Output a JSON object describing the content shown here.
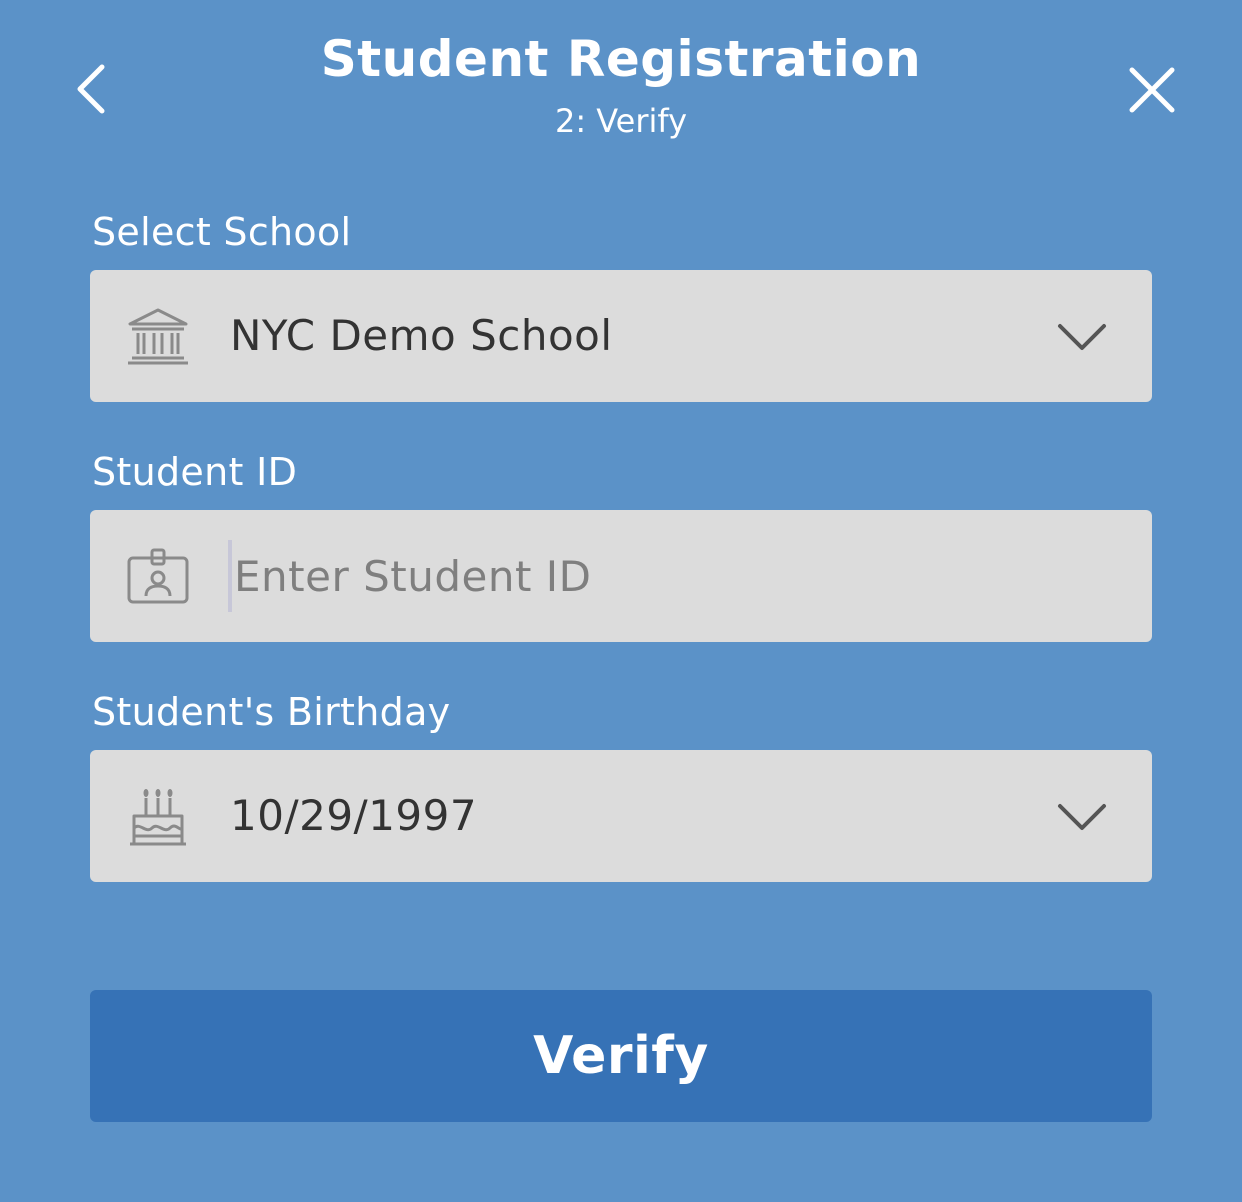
{
  "header": {
    "title": "Student Registration",
    "subtitle": "2: Verify",
    "back_icon": "chevron-left-icon",
    "close_icon": "close-icon"
  },
  "form": {
    "school": {
      "label": "Select School",
      "value": "NYC Demo School",
      "icon": "school-building-icon"
    },
    "student_id": {
      "label": "Student ID",
      "value": "",
      "placeholder": "Enter Student ID",
      "icon": "id-badge-icon"
    },
    "birthday": {
      "label": "Student's Birthday",
      "value": "10/29/1997",
      "icon": "birthday-cake-icon"
    }
  },
  "actions": {
    "verify_label": "Verify"
  },
  "colors": {
    "background": "#5b92c8",
    "field_background": "#dcdcdc",
    "button": "#3672b6",
    "text_light": "#ffffff",
    "text_dark": "#333333",
    "icon_gray": "#8a8a8a"
  }
}
